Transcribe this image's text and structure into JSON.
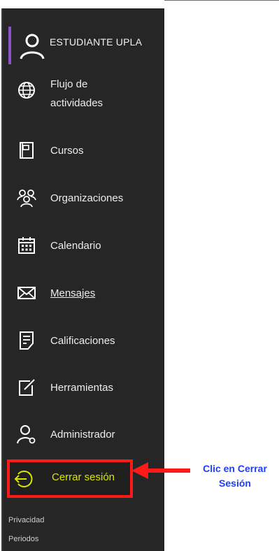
{
  "user": {
    "name": "ESTUDIANTE UPLA"
  },
  "nav": {
    "items": [
      {
        "label_line1": "Flujo de",
        "label_line2": "actividades"
      },
      {
        "label": "Cursos"
      },
      {
        "label": "Organizaciones"
      },
      {
        "label": "Calendario"
      },
      {
        "label": "Mensajes"
      },
      {
        "label": "Calificaciones"
      },
      {
        "label": "Herramientas"
      },
      {
        "label": "Administrador"
      }
    ],
    "logout": {
      "label": "Cerrar sesión"
    }
  },
  "footer": {
    "privacy": "Privacidad",
    "periods": "Periodos"
  },
  "annotation": {
    "line1": "Clic en Cerrar",
    "line2": "Sesión"
  },
  "colors": {
    "sidebar": "#262626",
    "accent": "#8c52c7",
    "highlight_border": "#ff1a1a",
    "logout_text": "#d9e600",
    "annotation_text": "#1f3cff"
  }
}
